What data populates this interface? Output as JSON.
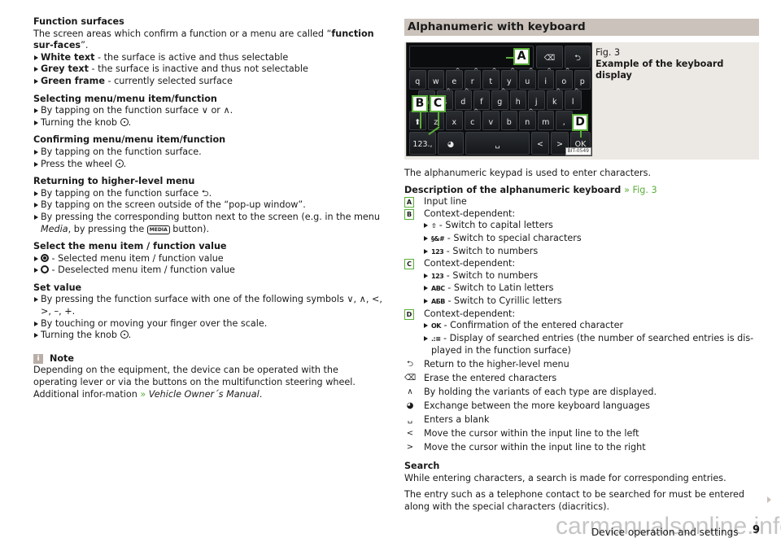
{
  "left": {
    "function_surfaces": {
      "title": "Function surfaces",
      "intro_a": "The screen areas which confirm a function or a menu are called “",
      "intro_bold": "function sur-faces",
      "intro_b": "”.",
      "items": [
        {
          "bold": "White text",
          "text": " - the surface is active and thus selectable"
        },
        {
          "bold": "Grey text",
          "text": " - the surface is inactive and thus not selectable"
        },
        {
          "bold": "Green frame",
          "text": " - currently selected surface"
        }
      ]
    },
    "selecting": {
      "title": "Selecting menu/menu item/function",
      "items": [
        "By tapping on the function surface ∨ or ∧.",
        "Turning the knob"
      ]
    },
    "confirming": {
      "title": "Confirming menu/menu item/function",
      "items": [
        "By tapping on the function surface.",
        "Press the wheel"
      ]
    },
    "returning": {
      "title": "Returning to higher-level menu",
      "item1": "By tapping on the function surface ⮌.",
      "item2": "By tapping on the screen outside of the “pop-up window”.",
      "item3_a": "By pressing the corresponding button next to the screen (e.g. in the menu ",
      "item3_italic": "Media",
      "item3_b": ", by pressing the ",
      "media_key": "MEDIA",
      "item3_c": " button)."
    },
    "select_value": {
      "title": "Select the menu item / function value",
      "selected": " - Selected menu item / function value",
      "deselected": " - Deselected menu item / function value"
    },
    "set_value": {
      "title": "Set value",
      "item1": "By pressing the function surface with one of the following symbols ∨, ∧, <, >, –, +.",
      "item2": "By touching or moving your finger over the scale.",
      "item3": "Turning the knob"
    },
    "note": {
      "icon": "i",
      "title": "Note",
      "text_a": "Depending on the equipment, the device can be operated with the operating lever or via the buttons on the multifunction steering wheel. Additional infor-mation ",
      "link_arrow": "»",
      "link_text": "Vehicle Owner´s Manual",
      "text_b": "."
    }
  },
  "right": {
    "heading": "Alphanumeric with keyboard",
    "figure": {
      "label": "Fig. 3",
      "caption": "Example of the keyboard display",
      "code": "BIT-0549",
      "callouts": [
        "A",
        "B",
        "C",
        "D"
      ],
      "keyboard": {
        "row1": [
          "q",
          "w",
          "e",
          "r",
          "t",
          "y",
          "u",
          "i",
          "o",
          "p"
        ],
        "row2": [
          "a",
          "s",
          "d",
          "f",
          "g",
          "h",
          "j",
          "k",
          "l"
        ],
        "row3": [
          "z",
          "x",
          "c",
          "v",
          "b",
          "n",
          "m",
          ","
        ],
        "bottom": {
          "numbers": "123.,",
          "space": "␣",
          "left": "<",
          "right": ">",
          "ok": "OK"
        }
      }
    },
    "intro": "The alphanumeric keypad is used to enter characters.",
    "desc_title": "Description of the alphanumeric keyboard",
    "desc_ref": "» Fig. 3",
    "legend": [
      {
        "label": "A",
        "text": "Input line",
        "subs": []
      },
      {
        "label": "B",
        "text": "Context-dependent:",
        "subs": [
          {
            "sym": "⇧",
            "text": " - Switch to capital letters"
          },
          {
            "sym": "§&#",
            "text": " - Switch to special characters"
          },
          {
            "sym": "123",
            "text": " - Switch to numbers"
          }
        ]
      },
      {
        "label": "C",
        "text": "Context-dependent:",
        "subs": [
          {
            "sym": "123",
            "text": " - Switch to numbers"
          },
          {
            "sym": "ABC",
            "text": " - Switch to Latin letters"
          },
          {
            "sym": "АБВ",
            "text": " - Switch to Cyrillic letters"
          }
        ]
      },
      {
        "label": "D",
        "text": "Context-dependent:",
        "subs": [
          {
            "sym": "OK",
            "text": " - Confirmation of the entered character"
          },
          {
            "sym": ".:≡",
            "text": " - Display of searched entries (the number of searched entries is dis-played in the function surface)"
          }
        ]
      }
    ],
    "icon_legend": [
      {
        "icon": "⮌",
        "name": "return-icon",
        "text": "Return to the higher-level menu"
      },
      {
        "icon": "⌫",
        "name": "erase-icon",
        "text": "Erase the entered characters"
      },
      {
        "icon": "∧",
        "name": "caret-up-icon",
        "text": "By holding the variants of each type are displayed."
      },
      {
        "icon": "◕",
        "name": "globe-icon",
        "text": "Exchange between the more keyboard languages"
      },
      {
        "icon": "␣",
        "name": "space-icon",
        "text": "Enters a blank"
      },
      {
        "icon": "<",
        "name": "cursor-left-icon",
        "text": "Move the cursor within the input line to the left"
      },
      {
        "icon": ">",
        "name": "cursor-right-icon",
        "text": "Move the cursor within the input line to the right"
      }
    ],
    "search": {
      "title": "Search",
      "text1": "While entering characters, a search is made for corresponding entries.",
      "text2": "The entry such as a telephone contact to be searched for must be entered along with the special characters (diacritics)."
    }
  },
  "footer": {
    "section": "Device operation and settings",
    "page": "9",
    "watermark": "carmanualsonline.info"
  }
}
